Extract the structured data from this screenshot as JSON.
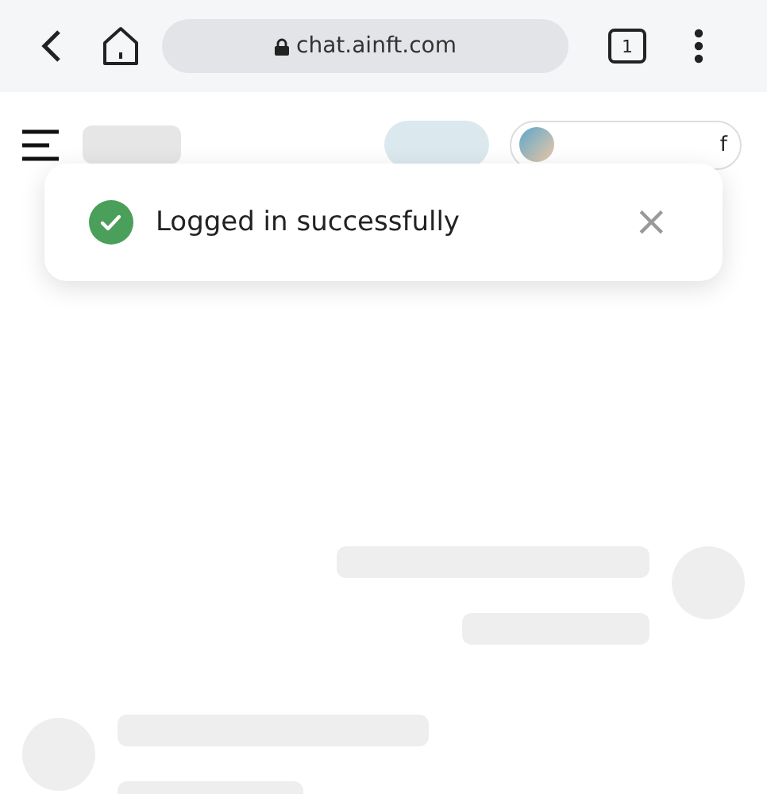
{
  "browser": {
    "url": "chat.ainft.com",
    "tab_count": "1"
  },
  "header": {
    "account_text": "f"
  },
  "toast": {
    "kind": "success",
    "message": "Logged in successfully",
    "close": "×"
  },
  "messages": [
    {
      "kind": "outgoing"
    },
    {
      "kind": "incoming"
    }
  ]
}
